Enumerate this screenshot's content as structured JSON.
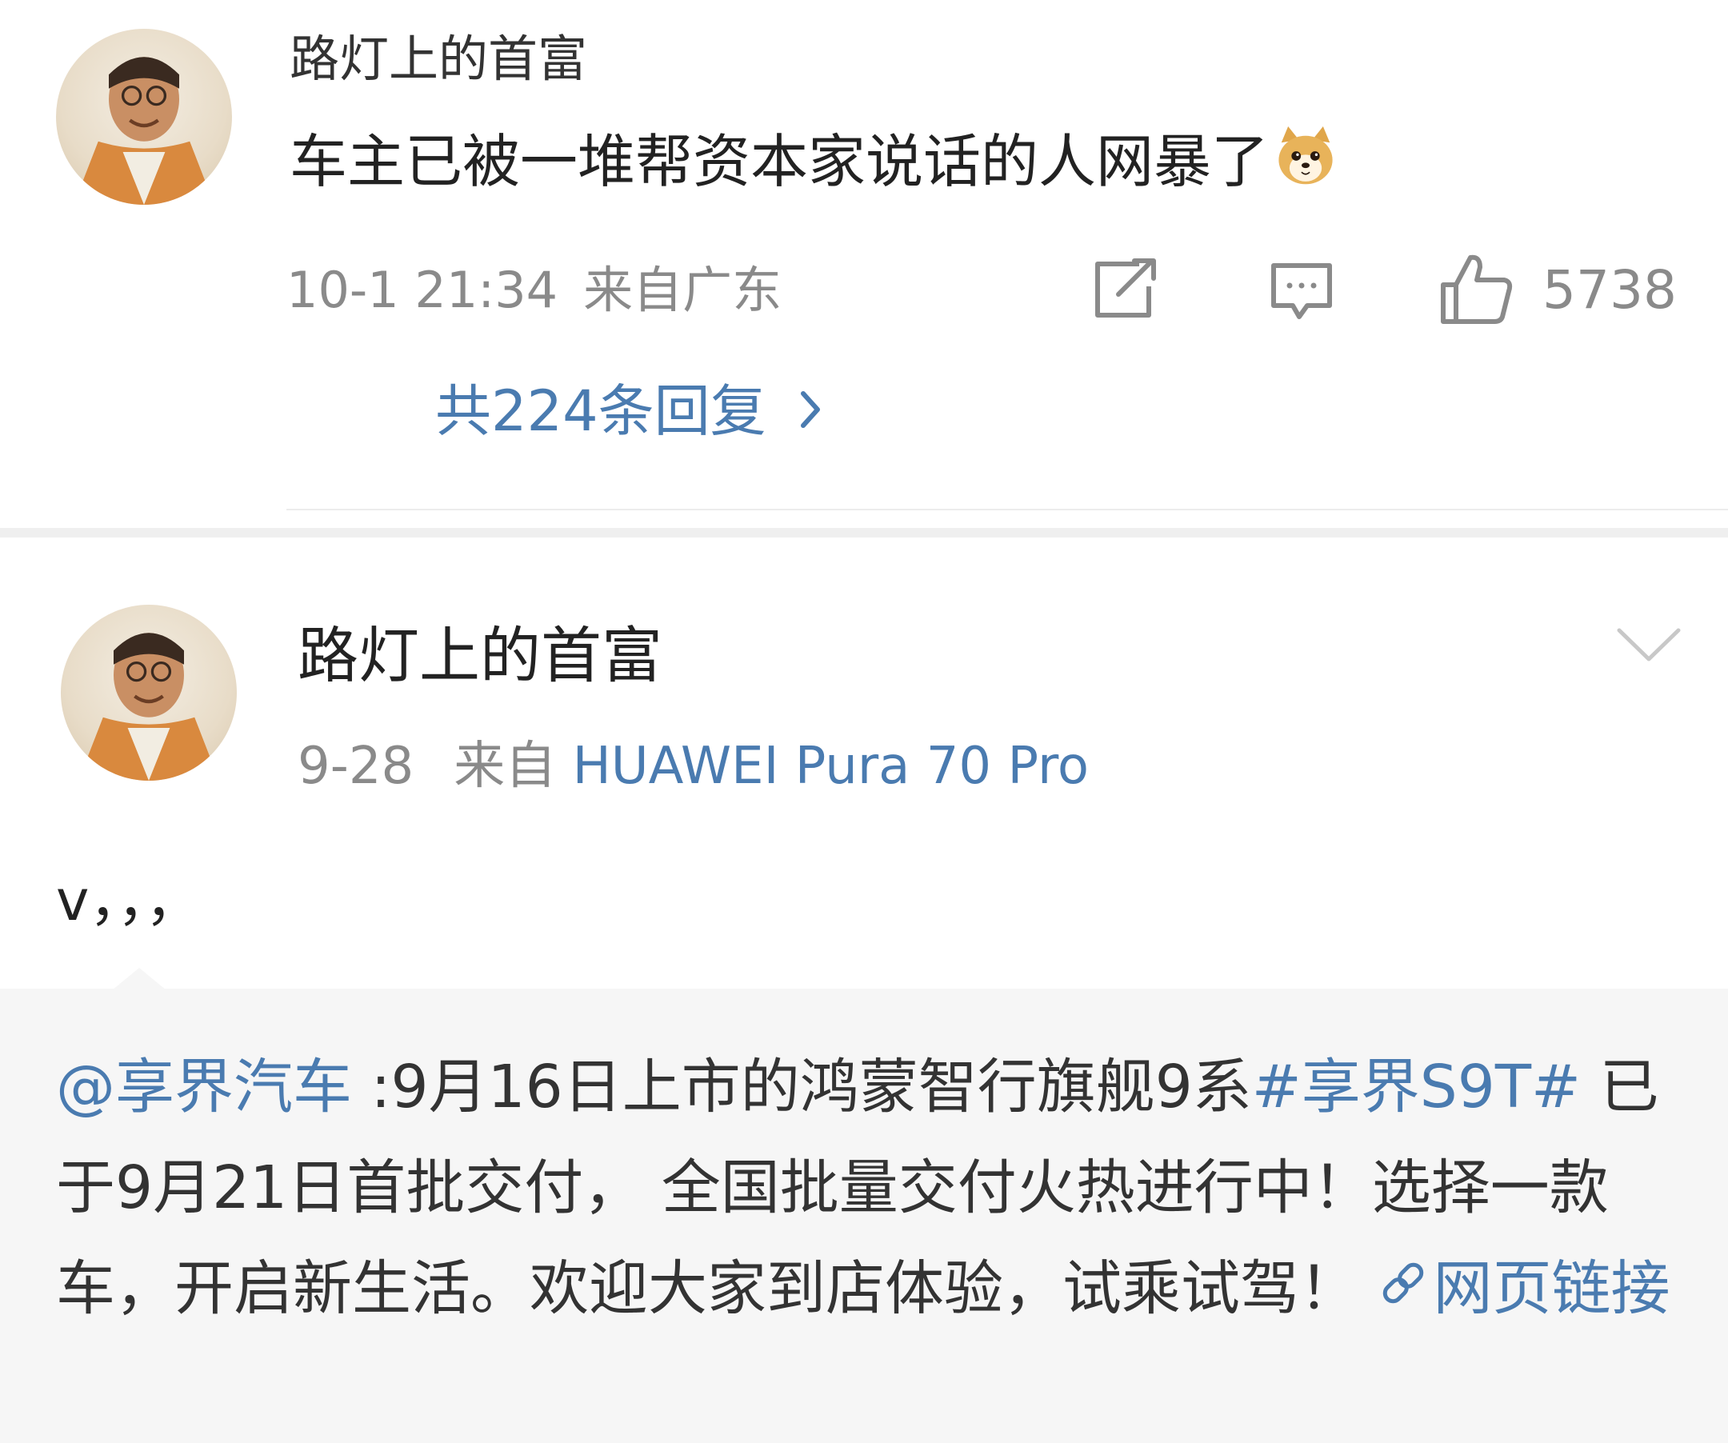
{
  "comment": {
    "author": "路灯上的首富",
    "text": "车主已被一堆帮资本家说话的人网暴了",
    "emoji": "doge-emoji",
    "time": "10-1 21:34",
    "location": "来自广东",
    "likes": "5738",
    "replies_label": "共224条回复"
  },
  "post": {
    "author": "路灯上的首富",
    "date": "9-28",
    "from_prefix": "来自",
    "device": "HUAWEI Pura 70 Pro",
    "text": "v，，，"
  },
  "repost": {
    "mention": "@享界汽车",
    "part1": " :9月16日上市的鸿蒙智行旗舰9系",
    "hashtag": "#享界S9T#",
    "part2": " 已于9月21日首批交付， 全国批量交付火热进行中！选择一款车，开启新生活。欢迎大家到店体验，试乘试驾！",
    "link_label": "网页链接"
  },
  "colors": {
    "link": "#4a7bb0",
    "muted": "#8a8a8a",
    "text": "#222222",
    "repost_bg": "#f6f6f6"
  },
  "icons": [
    "share-icon",
    "comment-icon",
    "like-icon",
    "chevron-right-icon",
    "chevron-down-icon",
    "link-icon",
    "doge-emoji"
  ]
}
